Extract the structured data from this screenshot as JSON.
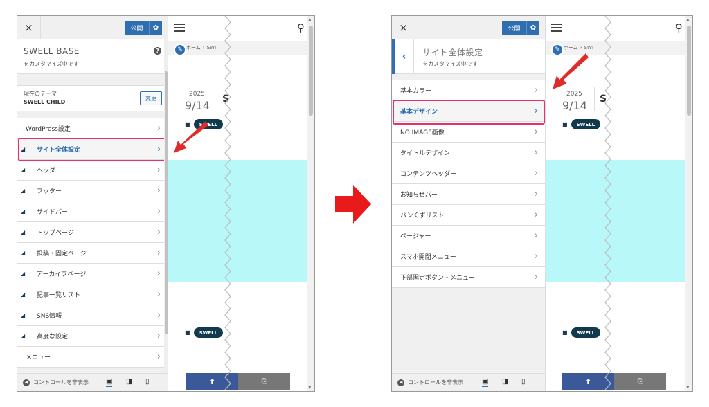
{
  "topbar": {
    "close": "×",
    "publish": "公開",
    "settings_icon": "gear-icon"
  },
  "left": {
    "title": "SWELL BASE",
    "subtitle": "をカスタマイズ中です",
    "theme_label": "現在のテーマ",
    "theme_name": "SWELL CHILD",
    "change_button": "変更",
    "items": [
      {
        "label": "WordPress設定",
        "icon": false
      },
      {
        "label": "サイト全体設定",
        "icon": true,
        "active": true
      },
      {
        "label": "ヘッダー",
        "icon": true
      },
      {
        "label": "フッター",
        "icon": true
      },
      {
        "label": "サイドバー",
        "icon": true
      },
      {
        "label": "トップページ",
        "icon": true
      },
      {
        "label": "投稿・固定ページ",
        "icon": true
      },
      {
        "label": "アーカイブページ",
        "icon": true
      },
      {
        "label": "記事一覧リスト",
        "icon": true
      },
      {
        "label": "SNS情報",
        "icon": true
      },
      {
        "label": "高度な設定",
        "icon": true
      },
      {
        "label": "メニュー",
        "icon": false
      }
    ]
  },
  "right": {
    "title": "サイト全体設定",
    "subtitle": "をカスタマイズ中です",
    "back_icon": "chevron-left-icon",
    "items": [
      {
        "label": "基本カラー"
      },
      {
        "label": "基本デザイン",
        "active": true
      },
      {
        "label": "NO IMAGE画像"
      },
      {
        "label": "タイトルデザイン"
      },
      {
        "label": "コンテンツヘッダー"
      },
      {
        "label": "お知らせバー"
      },
      {
        "label": "パンくずリスト"
      },
      {
        "label": "ページャー"
      },
      {
        "label": "スマホ開閉メニュー"
      },
      {
        "label": "下部固定ボタン・メニュー"
      }
    ]
  },
  "bottombar": {
    "hide_controls": "コントロールを非表示",
    "devices": [
      "desktop-icon",
      "tablet-icon",
      "mobile-icon"
    ]
  },
  "preview": {
    "breadcrumb_home": "ホーム",
    "breadcrumb_next": "SWI",
    "year": "2025",
    "date": "9/14",
    "tag": "SWELL",
    "share_fb": "f",
    "share_copy": "⎘"
  },
  "colors": {
    "accent": "#2f6fb1",
    "highlight": "#e8306a",
    "arrow": "#e02b2b",
    "cyan": "#b8f8f8"
  }
}
